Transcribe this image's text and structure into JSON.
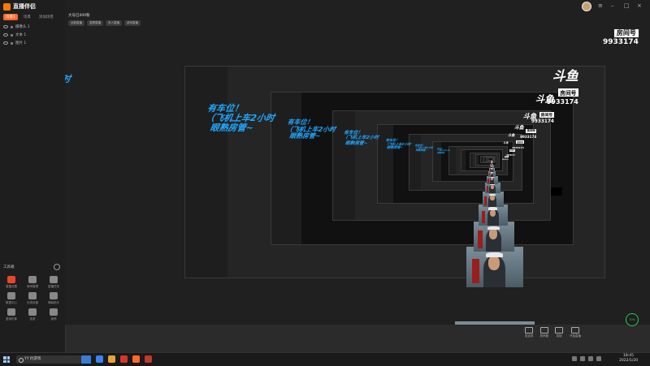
{
  "app": {
    "name": "直播伴侣",
    "version_chip": "",
    "tabs": [
      "场景1",
      "场景",
      "添加场景"
    ],
    "scenes": [
      {
        "label": "摄像头 1"
      },
      {
        "label": "文本 1"
      },
      {
        "label": "图片 1"
      }
    ],
    "tools_title": "工具箱",
    "tools": [
      {
        "label": "直播设置",
        "color": "red"
      },
      {
        "label": "房间管理",
        "color": "gray"
      },
      {
        "label": "直播任务",
        "color": "gray"
      },
      {
        "label": "数据中心",
        "color": "gray"
      },
      {
        "label": "礼物设置",
        "color": "gray"
      },
      {
        "label": "弹幕助手",
        "color": "gray"
      },
      {
        "label": "虚拟形象",
        "color": "gray"
      },
      {
        "label": "连麦",
        "color": "gray"
      },
      {
        "label": "美颜",
        "color": "gray"
      }
    ],
    "bottom_note": "全部"
  },
  "header": {
    "title": "大号已400粉",
    "chip": "",
    "pills": [
      "全能直播",
      "竖屏直播",
      "多人直播",
      "游戏直播"
    ]
  },
  "overlay": {
    "caption": "有车位！\n（飞机上车2小时\n  眼熟房管~",
    "caption_color": "#22a8ff",
    "douyu_logo": "斗鱼",
    "douyu_tag": "房间号",
    "room_number": "9933174"
  },
  "controls": [
    {
      "label": "麦克风"
    },
    {
      "label": "扬声器"
    },
    {
      "label": "录制"
    },
    {
      "label": "开始直播"
    }
  ],
  "status_badge": "70%",
  "taskbar": {
    "search_text": "YY 约游戏",
    "time": "18:45",
    "date": "2022/1/20"
  }
}
